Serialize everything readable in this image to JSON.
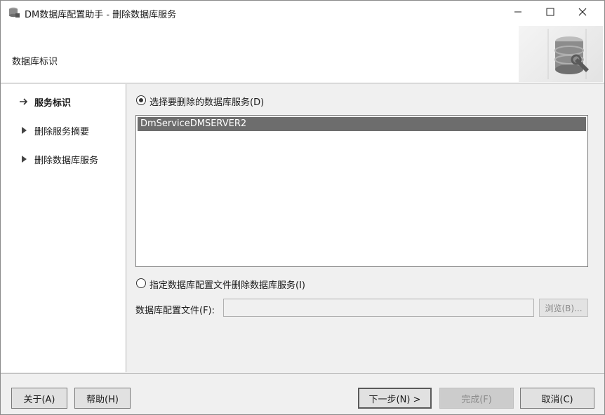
{
  "window": {
    "title": "DM数据库配置助手 - 删除数据库服务",
    "minimize_icon": "minimize-icon",
    "maximize_icon": "maximize-icon",
    "close_icon": "close-icon"
  },
  "header": {
    "title": "数据库标识",
    "art_icon": "database-wrench-icon"
  },
  "nav": {
    "items": [
      {
        "label": "服务标识",
        "active": true,
        "marker": "arrow-right-icon"
      },
      {
        "label": "删除服务摘要",
        "active": false,
        "marker": "triangle-right-icon"
      },
      {
        "label": "删除数据库服务",
        "active": false,
        "marker": "triangle-right-icon"
      }
    ]
  },
  "main": {
    "option_select_label": "选择要删除的数据库服务(D)",
    "option_select_checked": true,
    "services": [
      "DmServiceDMSERVER2"
    ],
    "selected_service": "DmServiceDMSERVER2",
    "option_file_label": "指定数据库配置文件删除数据库服务(I)",
    "option_file_checked": false,
    "config_file_label": "数据库配置文件(F):",
    "config_file_value": "",
    "browse_label": "浏览(B)..."
  },
  "footer": {
    "about_label": "关于(A)",
    "help_label": "帮助(H)",
    "next_label": "下一步(N) >",
    "finish_label": "完成(F)",
    "cancel_label": "取消(C)"
  },
  "colors": {
    "selection": "#6d6d6d",
    "panel": "#f0f0f0",
    "border": "#b5b5b5"
  }
}
